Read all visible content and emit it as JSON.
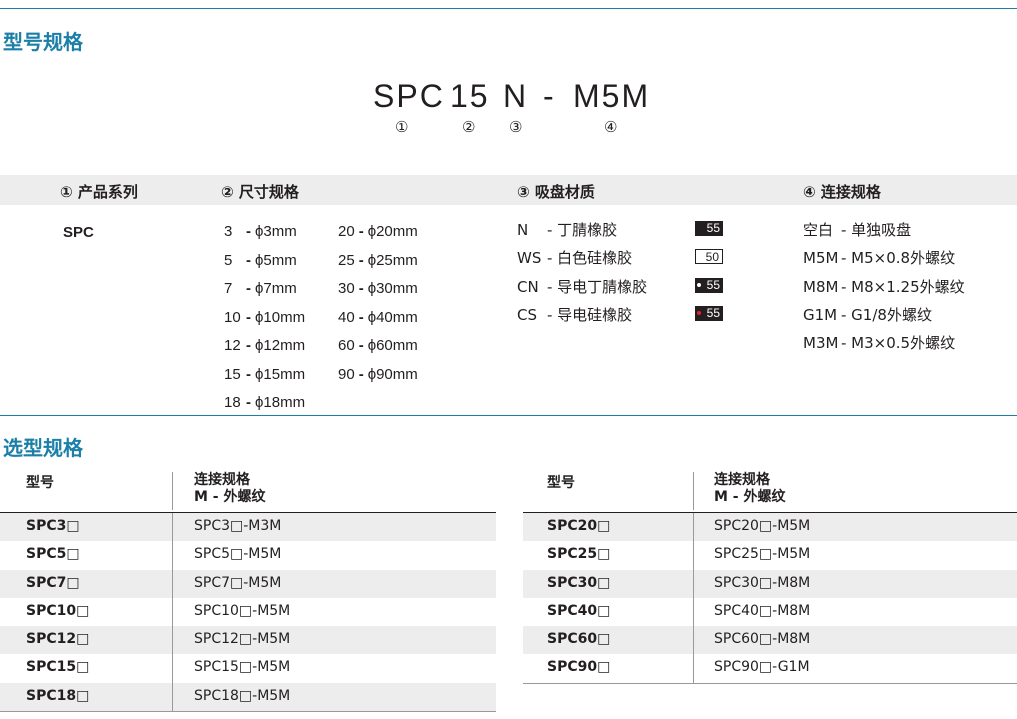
{
  "section1_title": "型号规格",
  "section2_title": "选型规格",
  "code": {
    "p1": "SPC",
    "p2": "15",
    "p3": "N",
    "p4": "-",
    "p5": "M5M"
  },
  "code_index": {
    "i1": "①",
    "i2": "②",
    "i3": "③",
    "i4": "④"
  },
  "spec_headers": {
    "series": "① 产品系列",
    "size": "② 尺寸规格",
    "material": "③ 吸盘材质",
    "connection": "④ 连接规格"
  },
  "series_value": "SPC",
  "sizes_left": [
    {
      "code": "3",
      "dash": "-",
      "size": "ϕ3mm"
    },
    {
      "code": "5",
      "dash": "-",
      "size": "ϕ5mm"
    },
    {
      "code": "7",
      "dash": "-",
      "size": "ϕ7mm"
    },
    {
      "code": "10",
      "dash": "-",
      "size": "ϕ10mm"
    },
    {
      "code": "12",
      "dash": "-",
      "size": "ϕ12mm"
    },
    {
      "code": "15",
      "dash": "-",
      "size": "ϕ15mm"
    },
    {
      "code": "18",
      "dash": "-",
      "size": "ϕ18mm"
    }
  ],
  "sizes_right": [
    {
      "code": "20",
      "dash": "-",
      "size": "ϕ20mm"
    },
    {
      "code": "25",
      "dash": "-",
      "size": "ϕ25mm"
    },
    {
      "code": "30",
      "dash": "-",
      "size": "ϕ30mm"
    },
    {
      "code": "40",
      "dash": "-",
      "size": "ϕ40mm"
    },
    {
      "code": "60",
      "dash": "-",
      "size": "ϕ60mm"
    },
    {
      "code": "90",
      "dash": "-",
      "size": "ϕ90mm"
    }
  ],
  "materials": [
    {
      "code": "N",
      "name": "- 丁腈橡胶",
      "hardness": "55",
      "style": "dark",
      "dot": ""
    },
    {
      "code": "WS",
      "name": "- 白色硅橡胶",
      "hardness": "50",
      "style": "light",
      "dot": ""
    },
    {
      "code": "CN",
      "name": "- 导电丁腈橡胶",
      "hardness": "55",
      "style": "dark",
      "dot": "#ffffff"
    },
    {
      "code": "CS",
      "name": "- 导电硅橡胶",
      "hardness": "55",
      "style": "dark",
      "dot": "#e0242b"
    }
  ],
  "connections": [
    {
      "code": "空白",
      "name": "- 单独吸盘"
    },
    {
      "code": "M5M",
      "name": "- M5×0.8外螺纹"
    },
    {
      "code": "M8M",
      "name": "- M8×1.25外螺纹"
    },
    {
      "code": "G1M",
      "name": "- G1/8外螺纹"
    },
    {
      "code": "M3M",
      "name": "- M3×0.5外螺纹"
    }
  ],
  "selection": {
    "col_model": "型号",
    "col_conn_line1": "连接规格",
    "col_conn_line2": "M - 外螺纹",
    "left_rows": [
      {
        "model": "SPC3□",
        "conn": "SPC3□-M3M"
      },
      {
        "model": "SPC5□",
        "conn": "SPC5□-M5M"
      },
      {
        "model": "SPC7□",
        "conn": "SPC7□-M5M"
      },
      {
        "model": "SPC10□",
        "conn": "SPC10□-M5M"
      },
      {
        "model": "SPC12□",
        "conn": "SPC12□-M5M"
      },
      {
        "model": "SPC15□",
        "conn": "SPC15□-M5M"
      },
      {
        "model": "SPC18□",
        "conn": "SPC18□-M5M"
      }
    ],
    "right_rows": [
      {
        "model": "SPC20□",
        "conn": "SPC20□-M5M"
      },
      {
        "model": "SPC25□",
        "conn": "SPC25□-M5M"
      },
      {
        "model": "SPC30□",
        "conn": "SPC30□-M8M"
      },
      {
        "model": "SPC40□",
        "conn": "SPC40□-M8M"
      },
      {
        "model": "SPC60□",
        "conn": "SPC60□-M8M"
      },
      {
        "model": "SPC90□",
        "conn": "SPC90□-G1M"
      }
    ]
  },
  "colors": {
    "accent": "#1b7fa8",
    "text": "#231f20",
    "shade": "#ededed",
    "red_dot": "#e0242b"
  }
}
